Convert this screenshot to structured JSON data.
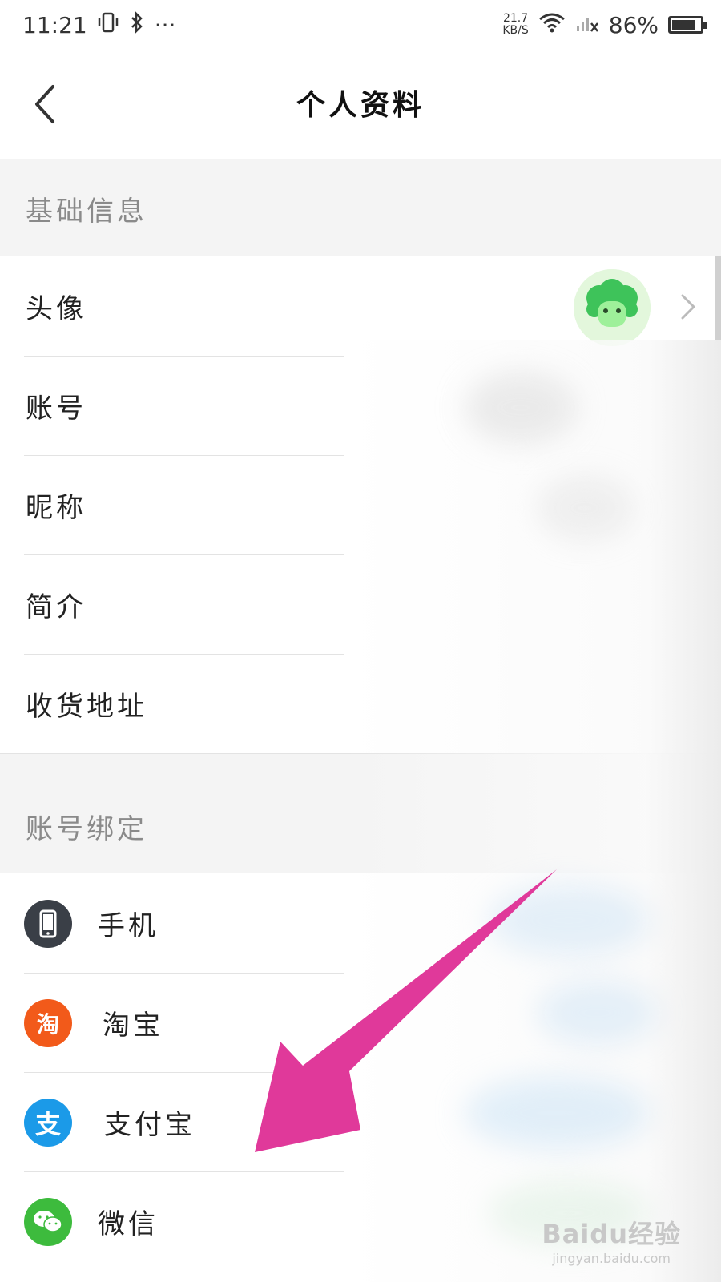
{
  "status_bar": {
    "time": "11:21",
    "extra": "···",
    "speed_value": "21.7",
    "speed_unit": "KB/S",
    "battery_percent": "86%",
    "battery_level": 0.86
  },
  "header": {
    "title": "个人资料"
  },
  "sections": {
    "basic": {
      "title": "基础信息",
      "rows": {
        "avatar": "头像",
        "account": "账号",
        "nickname": "昵称",
        "bio": "简介",
        "address": "收货地址"
      }
    },
    "binding": {
      "title": "账号绑定",
      "rows": {
        "phone": "手机",
        "taobao": "淘宝",
        "alipay": "支付宝",
        "wechat": "微信"
      }
    }
  },
  "icons": {
    "phone_icon": {
      "name": "phone-icon",
      "color": "#3a3f47"
    },
    "taobao_icon": {
      "name": "taobao-icon",
      "color": "#f25a1a",
      "glyph": "淘"
    },
    "alipay_icon": {
      "name": "alipay-icon",
      "color": "#1b9ae8",
      "glyph": "支"
    },
    "wechat_icon": {
      "name": "wechat-icon",
      "color": "#3dbb3d"
    }
  },
  "annotation_arrow_color": "#e0399a",
  "watermark": {
    "logo": "Baidu经验",
    "url": "jingyan.baidu.com"
  }
}
